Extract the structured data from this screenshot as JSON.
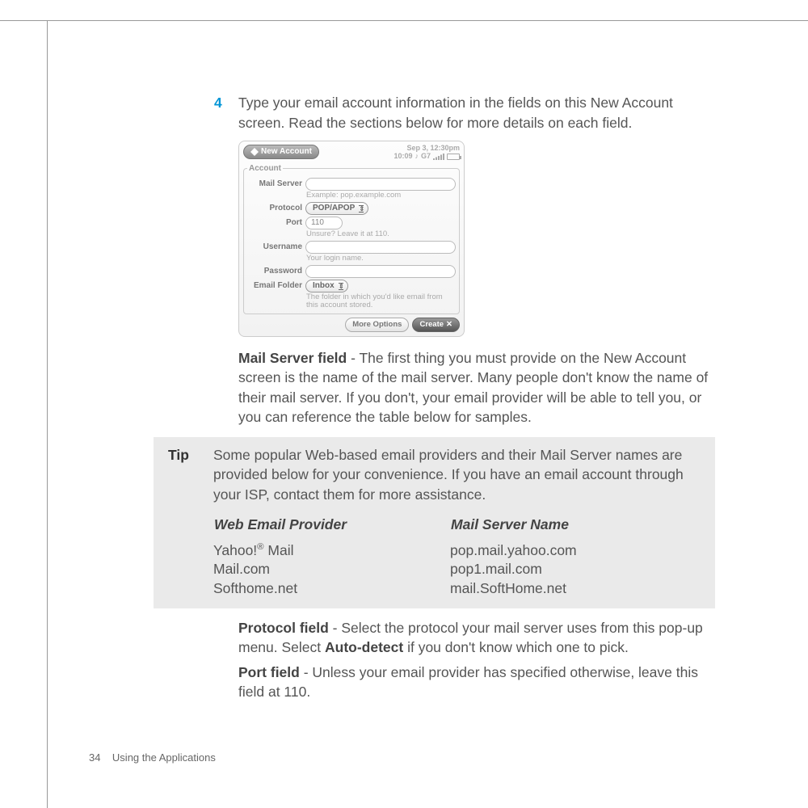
{
  "step": {
    "number": "4",
    "text": "Type your email account information in the fields on this New Account screen. Read the sections below for more details on each field."
  },
  "screenshot": {
    "title": "New Account",
    "date": "Sep 3, 12:30pm",
    "time": "10:09",
    "carrier": "G7",
    "legend": "Account",
    "fields": {
      "mail_server_label": "Mail Server",
      "mail_server_hint": "Example: pop.example.com",
      "protocol_label": "Protocol",
      "protocol_value": "POP/APOP",
      "port_label": "Port",
      "port_value": "110",
      "port_hint": "Unsure? Leave it at 110.",
      "username_label": "Username",
      "username_hint": "Your login name.",
      "password_label": "Password",
      "folder_label": "Email Folder",
      "folder_value": "Inbox",
      "folder_hint": "The folder in which you'd like email from this account stored."
    },
    "buttons": {
      "more": "More Options",
      "create": "Create"
    }
  },
  "mail_server_para": {
    "label": "Mail Server field",
    "text": " - The first thing you must provide on the New Account screen is the name of the mail server. Many people don't know the name of their mail server. If you don't, your email provider will be able to tell you, or you can reference the table below for samples."
  },
  "tip": {
    "label": "Tip",
    "text": "Some popular Web-based email providers and their Mail Server names are provided below for your convenience. If you have an email account through your ISP, contact them for more assistance.",
    "table": {
      "col1": "Web Email Provider",
      "col2": "Mail Server Name",
      "rows": [
        {
          "provider": "Yahoo!",
          "reg": "®",
          "suffix": " Mail",
          "server": "pop.mail.yahoo.com"
        },
        {
          "provider": "Mail.com",
          "reg": "",
          "suffix": "",
          "server": "pop1.mail.com"
        },
        {
          "provider": "Softhome.net",
          "reg": "",
          "suffix": "",
          "server": "mail.SoftHome.net"
        }
      ]
    }
  },
  "protocol_para": {
    "label": "Protocol field",
    "text": " - Select the protocol your mail server uses from this pop-up menu. Select ",
    "bold": "Auto-detect",
    "text2": " if you don't know which one to pick."
  },
  "port_para": {
    "label": "Port field",
    "text": " - Unless your email provider has specified otherwise, leave this field at 110."
  },
  "footer": {
    "page": "34",
    "section": "Using the Applications"
  }
}
